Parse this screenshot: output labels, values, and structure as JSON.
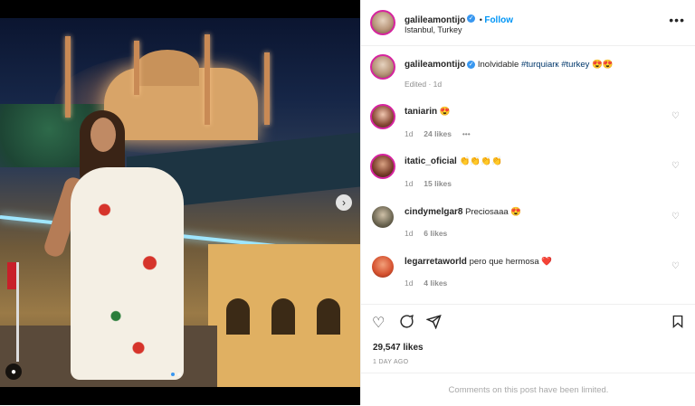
{
  "post": {
    "author": "galileamontijo",
    "location": "Istanbul, Turkey",
    "follow_label": "Follow",
    "more_label": "•••",
    "caption_user": "galileamontijo",
    "caption_text": "Inolvidable ",
    "caption_tag1": "#turquiarк",
    "caption_tag2": "#turkey",
    "caption_emoji": "😍😍",
    "edited": "Edited · 1d"
  },
  "comments": [
    {
      "user": "taniarin",
      "text": "😍",
      "age": "1d",
      "likes": "24 likes",
      "extra": "•••"
    },
    {
      "user": "itatic_oficial",
      "text": "👏👏👏👏",
      "age": "1d",
      "likes": "15 likes"
    },
    {
      "user": "cindymelgar8",
      "text": "Preciosaaa 😍",
      "age": "1d",
      "likes": "6 likes"
    },
    {
      "user": "legarretaworld",
      "text": "pero que hermosa ❤️",
      "age": "1d",
      "likes": "4 likes"
    }
  ],
  "footer": {
    "likes": "29,547 likes",
    "when": "1 DAY AGO",
    "limited": "Comments on this post have been limited."
  },
  "icons": {
    "like": "heart-icon",
    "comment": "comment-icon",
    "share": "share-icon",
    "save": "bookmark-icon",
    "next": "chevron-right-icon",
    "user_tag": "user-tag-icon"
  },
  "colors": {
    "accent": "#0095f6",
    "verified": "#3897f0",
    "story_ring": "#d6249f",
    "hashtag": "#00376b"
  }
}
